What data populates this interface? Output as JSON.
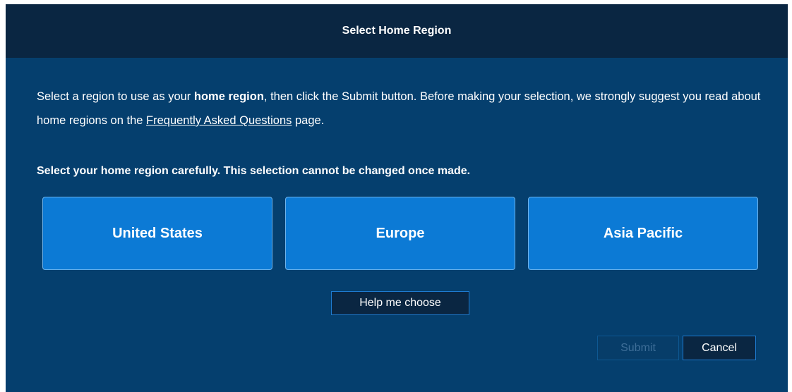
{
  "dialog": {
    "title": "Select Home Region"
  },
  "intro": {
    "part1": "Select a region to use as your ",
    "bold": "home region",
    "part2": ", then click the Submit button.  Before making your selection, we strongly suggest you read about home regions on the ",
    "link_text": "Frequently Asked Questions",
    "part3": " page."
  },
  "warning": "Select your home region carefully. This selection cannot be changed once made.",
  "regions": [
    {
      "label": "United States"
    },
    {
      "label": "Europe"
    },
    {
      "label": "Asia Pacific"
    }
  ],
  "buttons": {
    "help_label": "Help me choose",
    "submit_label": "Submit",
    "cancel_label": "Cancel"
  },
  "colors": {
    "dialog_bg": "#053f6e",
    "titlebar_bg": "#0a2642",
    "region_button_bg": "#0c7ad5",
    "accent_border": "#1e7bd0"
  }
}
